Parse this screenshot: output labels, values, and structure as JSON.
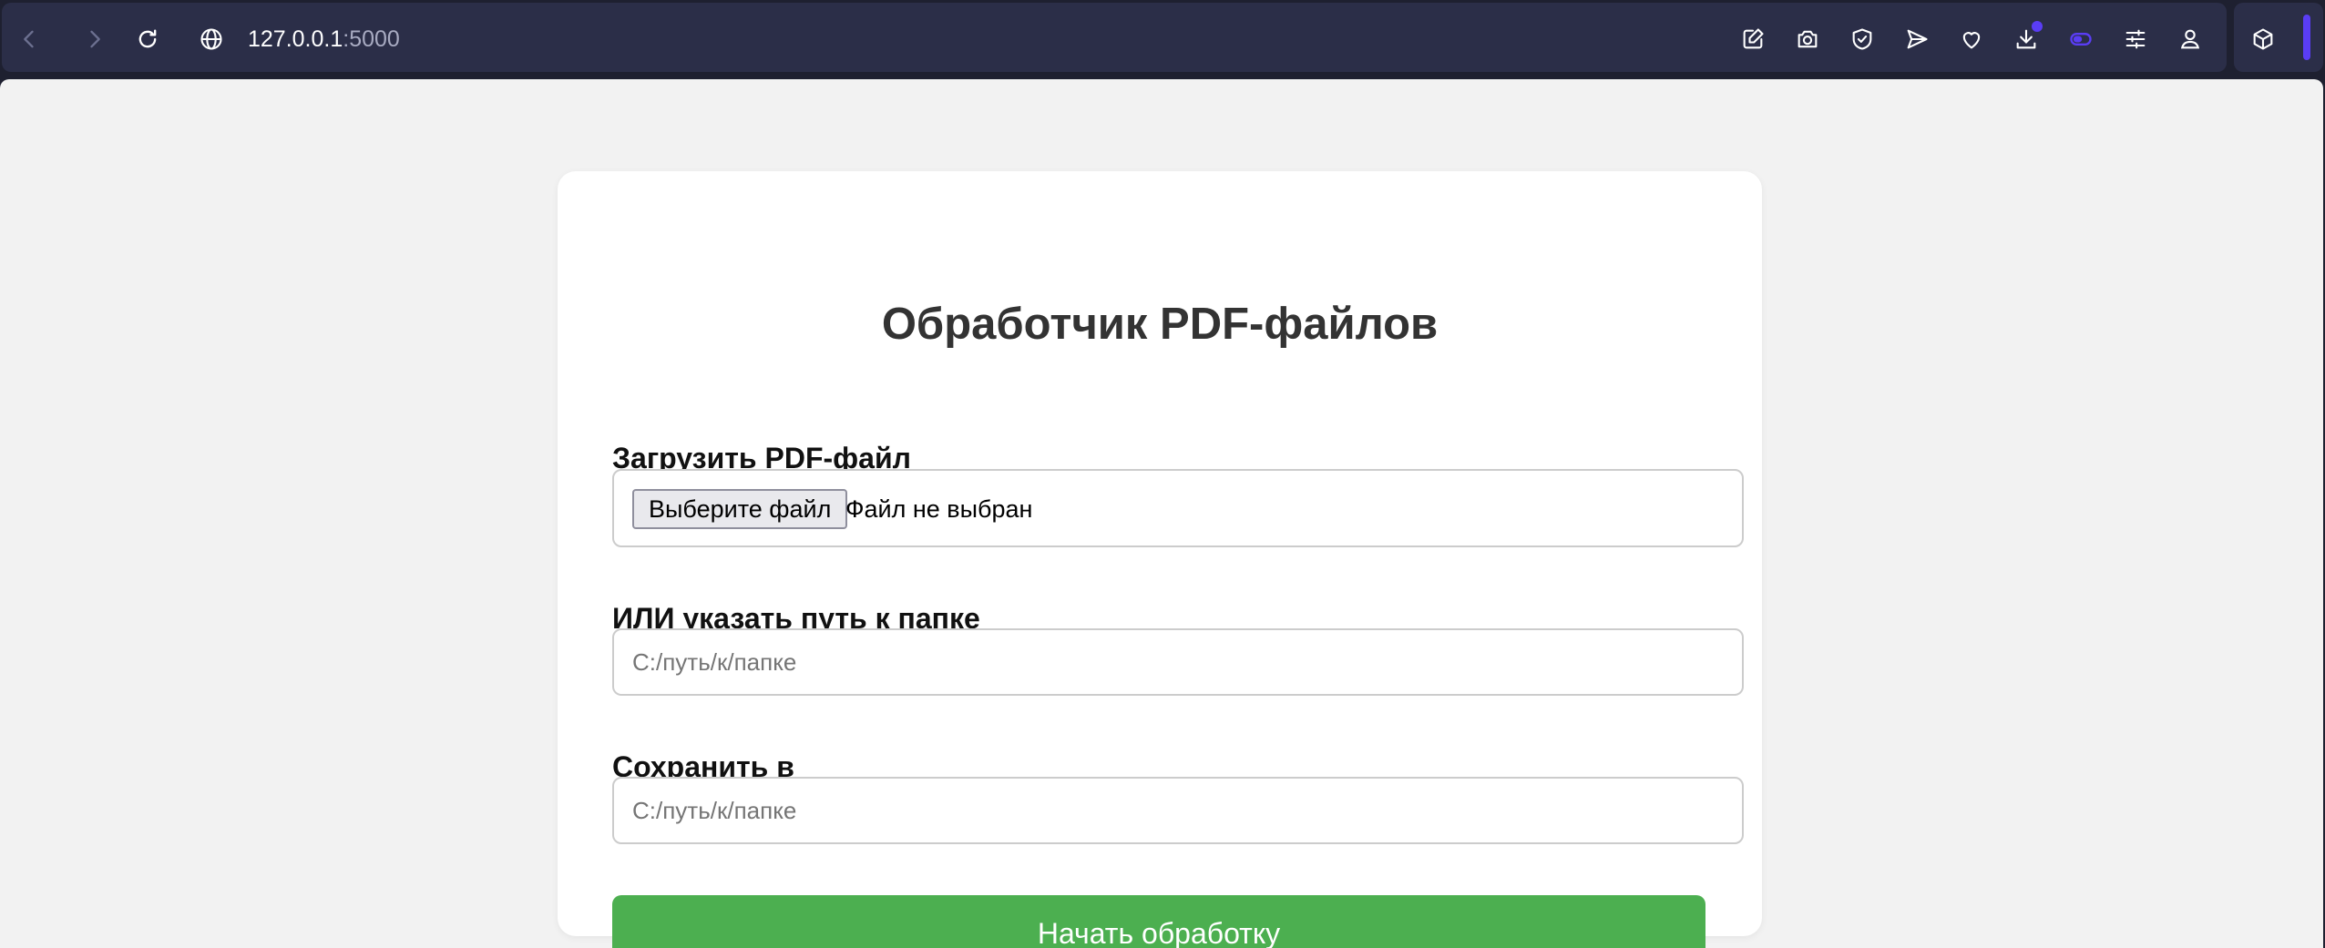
{
  "browser": {
    "url_host": "127.0.0.1",
    "url_port": ":5000",
    "accent_color": "#5a3df5",
    "toolbar_icons": [
      "back-icon",
      "forward-icon",
      "reload-icon",
      "globe-icon",
      "edit-note-icon",
      "camera-icon",
      "shield-check-icon",
      "send-icon",
      "heart-icon",
      "download-icon",
      "toggle-icon",
      "settings-sliders-icon",
      "profile-icon",
      "extensions-cube-icon"
    ]
  },
  "page": {
    "title": "Обработчик PDF-файлов",
    "upload": {
      "label": "Загрузить PDF-файл",
      "button_label": "Выберите файл",
      "status": "Файл не выбран"
    },
    "folder": {
      "label": "ИЛИ указать путь к папке",
      "value": "",
      "placeholder": "C:/путь/к/папке"
    },
    "save": {
      "label": "Сохранить в",
      "value": "",
      "placeholder": "C:/путь/к/папке"
    },
    "submit_label": "Начать обработку",
    "submit_color": "#4caf50"
  }
}
